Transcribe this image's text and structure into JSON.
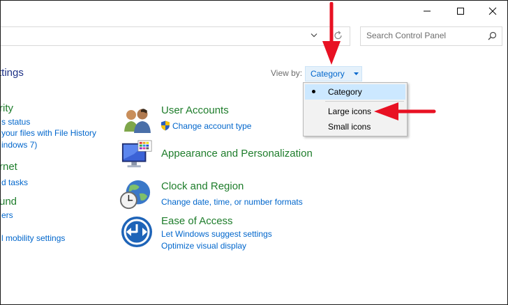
{
  "search": {
    "placeholder": "Search Control Panel"
  },
  "page_title": "ttings",
  "view_by": {
    "label": "View by:",
    "selected": "Category",
    "options": [
      "Category",
      "Large icons",
      "Small icons"
    ]
  },
  "left_column": [
    {
      "text": "rity",
      "kind": "title"
    },
    {
      "text": "s status",
      "kind": "link"
    },
    {
      "text": "your files with File History",
      "kind": "link"
    },
    {
      "text": "indows 7)",
      "kind": "link"
    },
    {
      "text": "rnet",
      "kind": "title"
    },
    {
      "text": "d tasks",
      "kind": "link"
    },
    {
      "text": "und",
      "kind": "title"
    },
    {
      "text": "ers",
      "kind": "link"
    },
    {
      "text": "l mobility settings",
      "kind": "link"
    }
  ],
  "categories": [
    {
      "title": "User Accounts",
      "icon": "user-accounts-icon",
      "links": [
        "Change account type"
      ]
    },
    {
      "title": "Appearance and Personalization",
      "icon": "appearance-icon",
      "links": []
    },
    {
      "title": "Clock and Region",
      "icon": "clock-region-icon",
      "links": [
        "Change date, time, or number formats"
      ]
    },
    {
      "title": "Ease of Access",
      "icon": "ease-of-access-icon",
      "links": [
        "Let Windows suggest settings",
        "Optimize visual display"
      ]
    }
  ],
  "colors": {
    "link": "#0066cc",
    "category": "#1e7d2b",
    "title": "#1e3287",
    "annotation": "#e81123"
  }
}
